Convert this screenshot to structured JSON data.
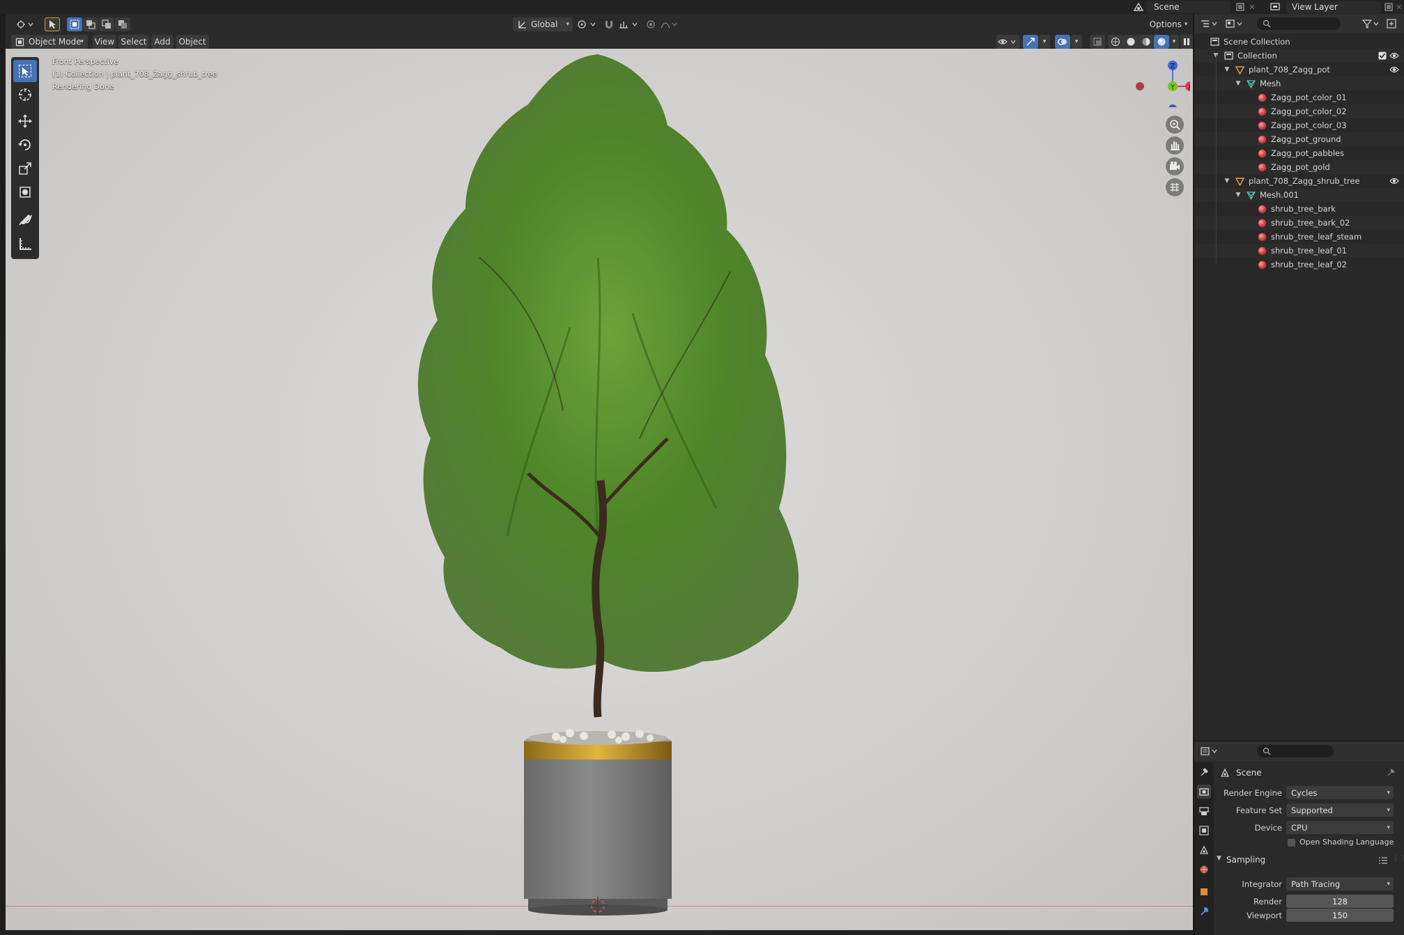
{
  "topbar": {
    "scene_label": "Scene",
    "view_layer_label": "View Layer"
  },
  "header": {
    "mode": "Object Mode",
    "menus": [
      "View",
      "Select",
      "Add",
      "Object"
    ],
    "transform_orientation": "Global",
    "options_label": "Options"
  },
  "viewport": {
    "overlay_line1": "Front Perspective",
    "overlay_line2": "(1) Collection | plant_708_Zagg_shrub_tree",
    "overlay_line3": "Rendering Done",
    "gizmo": {
      "z": "Z",
      "y": "Y",
      "x": "X"
    }
  },
  "outliner": {
    "root": "Scene Collection",
    "rows": [
      {
        "label": "Collection",
        "type": "collection",
        "indent": 0
      },
      {
        "label": "plant_708_Zagg_pot",
        "type": "object",
        "indent": 1
      },
      {
        "label": "Mesh",
        "type": "mesh",
        "indent": 2
      },
      {
        "label": "Zagg_pot_color_01",
        "type": "material",
        "indent": 3
      },
      {
        "label": "Zagg_pot_color_02",
        "type": "material",
        "indent": 3
      },
      {
        "label": "Zagg_pot_color_03",
        "type": "material",
        "indent": 3
      },
      {
        "label": "Zagg_pot_ground",
        "type": "material",
        "indent": 3
      },
      {
        "label": "Zagg_pot_pabbles",
        "type": "material",
        "indent": 3
      },
      {
        "label": "Zagg_pot_gold",
        "type": "material",
        "indent": 3
      },
      {
        "label": "plant_708_Zagg_shrub_tree",
        "type": "object",
        "indent": 1
      },
      {
        "label": "Mesh.001",
        "type": "mesh",
        "indent": 2
      },
      {
        "label": "shrub_tree_bark",
        "type": "material",
        "indent": 3
      },
      {
        "label": "shrub_tree_bark_02",
        "type": "material",
        "indent": 3
      },
      {
        "label": "shrub_tree_leaf_steam",
        "type": "material",
        "indent": 3
      },
      {
        "label": "shrub_tree_leaf_01",
        "type": "material",
        "indent": 3
      },
      {
        "label": "shrub_tree_leaf_02",
        "type": "material",
        "indent": 3
      }
    ]
  },
  "properties": {
    "context": "Scene",
    "render_engine_label": "Render Engine",
    "render_engine": "Cycles",
    "feature_set_label": "Feature Set",
    "feature_set": "Supported",
    "device_label": "Device",
    "device": "CPU",
    "osl_label": "Open Shading Language",
    "sampling_label": "Sampling",
    "integrator_label": "Integrator",
    "integrator": "Path Tracing",
    "render_label": "Render",
    "render_samples": "128",
    "viewport_label": "Viewport",
    "viewport_samples": "150"
  },
  "colors": {
    "accent": "#4772b3",
    "foliage": "#5a8f2e",
    "pot": "#7b7b7b",
    "gold": "#c9a22c"
  }
}
